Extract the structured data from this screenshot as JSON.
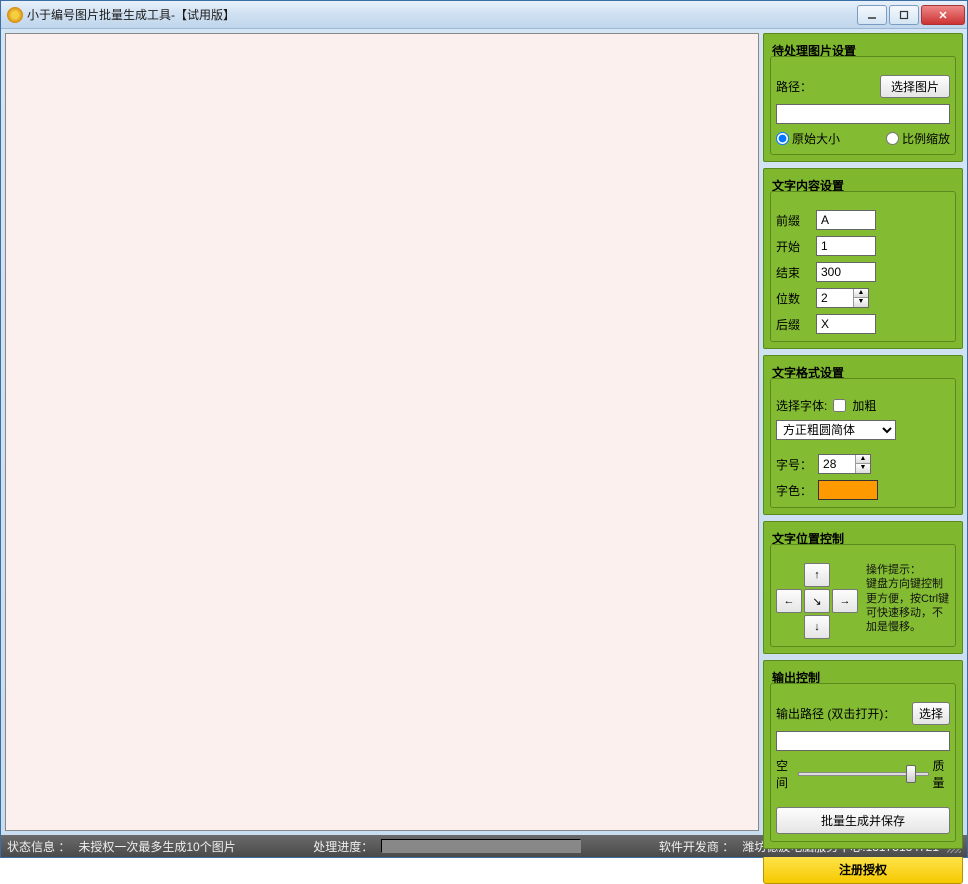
{
  "window": {
    "title": "小于编号图片批量生成工具-【试用版】"
  },
  "panels": {
    "image_settings": {
      "title": "待处理图片设置",
      "path_label": "路径：",
      "path_value": "",
      "select_image_btn": "选择图片",
      "radio_original": "原始大小",
      "radio_scale": "比例缩放"
    },
    "text_content": {
      "title": "文字内容设置",
      "prefix_label": "前缀",
      "prefix_value": "A",
      "start_label": "开始",
      "start_value": "1",
      "end_label": "结束",
      "end_value": "300",
      "digits_label": "位数",
      "digits_value": "2",
      "suffix_label": "后缀",
      "suffix_value": "X"
    },
    "text_format": {
      "title": "文字格式设置",
      "font_select_label": "选择字体:",
      "bold_label": "加粗",
      "font_value": "方正粗圆简体",
      "size_label": "字号：",
      "size_value": "28",
      "color_label": "字色：",
      "color_value": "#ff9900"
    },
    "position": {
      "title": "文字位置控制",
      "hint": "操作提示：\n键盘方向键控制更方便，按Ctrl键可快速移动，不加是慢移。"
    },
    "output": {
      "title": "输出控制",
      "path_label": "输出路径 (双击打开)：",
      "select_btn": "选择",
      "path_value": "",
      "slider_left": "空间",
      "slider_right": "质量",
      "slider_value": "90",
      "generate_btn": "批量生成并保存"
    },
    "register_btn": "注册授权"
  },
  "statusbar": {
    "status_label": "状态信息 ：",
    "status_text": "未授权一次最多生成10个图片",
    "progress_label": "处理进度：",
    "vendor_label": "软件开发商 ：",
    "vendor_text": "潍坊德波电脑服务中心:13173134721"
  }
}
